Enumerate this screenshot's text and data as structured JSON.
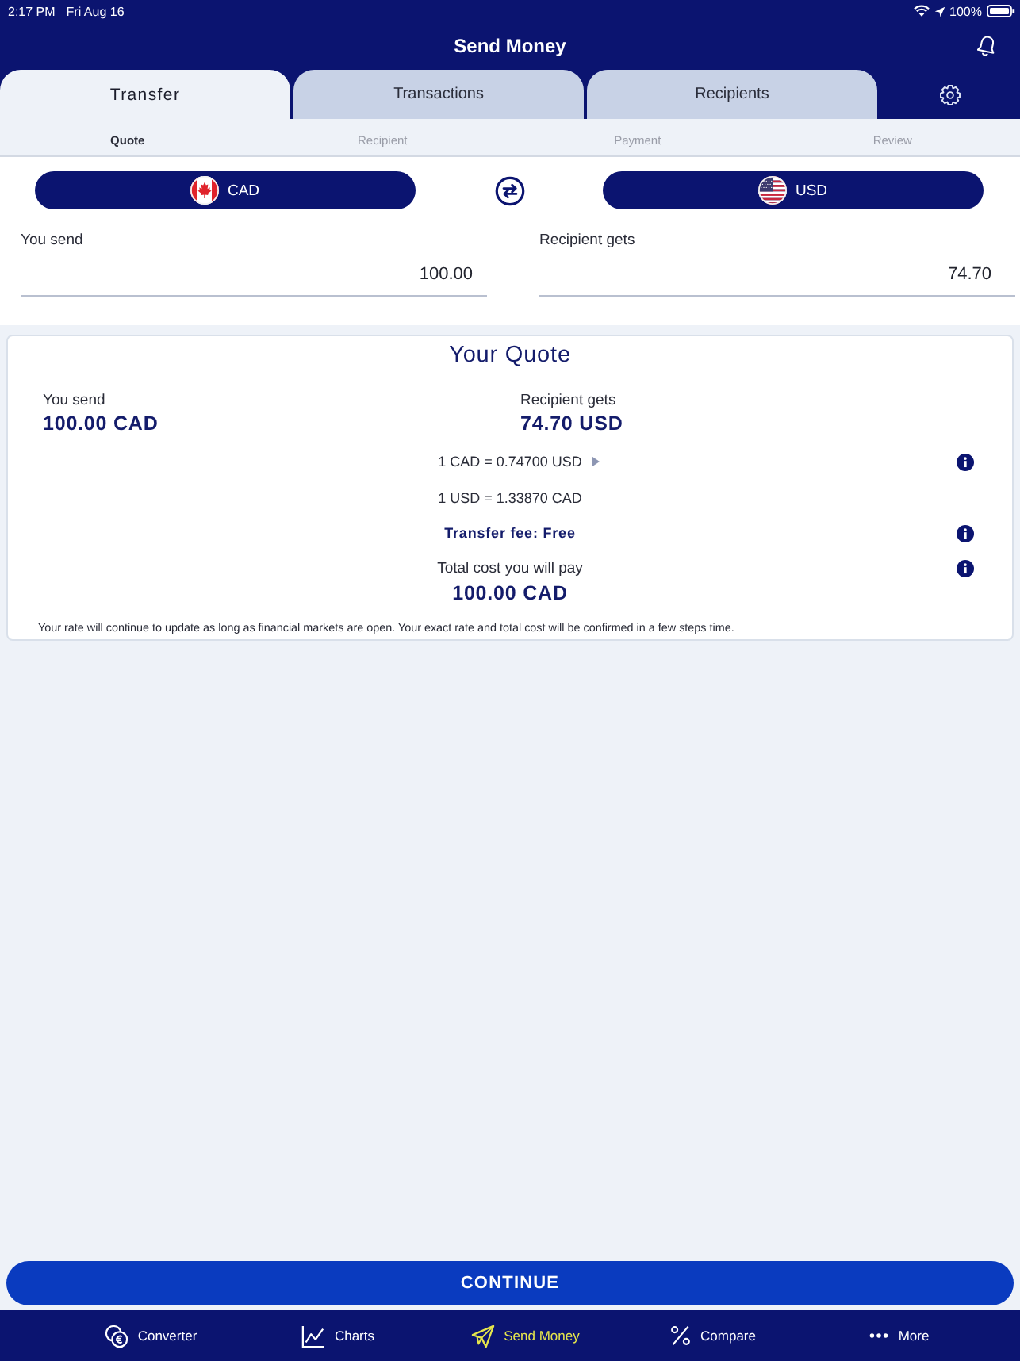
{
  "status_bar": {
    "time": "2:17 PM",
    "date": "Fri Aug 16",
    "battery": "100%"
  },
  "header": {
    "title": "Send Money"
  },
  "tabs": [
    {
      "label": "Transfer",
      "selected": true
    },
    {
      "label": "Transactions",
      "selected": false
    },
    {
      "label": "Recipients",
      "selected": false
    }
  ],
  "steps": [
    {
      "label": "Quote",
      "selected": true
    },
    {
      "label": "Recipient",
      "selected": false
    },
    {
      "label": "Payment",
      "selected": false
    },
    {
      "label": "Review",
      "selected": false
    }
  ],
  "currencies": [
    {
      "code": "CAD"
    },
    {
      "code": "USD"
    }
  ],
  "amounts": [
    {
      "label": "You send",
      "value": "100.00"
    },
    {
      "label": "Recipient gets",
      "value": "74.70"
    }
  ],
  "quote": {
    "title": "Your Quote",
    "amounts": [
      {
        "label": "You send",
        "value": "100.00 CAD"
      },
      {
        "label": "Recipient gets",
        "value": "74.70 USD"
      }
    ],
    "rows": [
      {
        "kind": "rate",
        "text": "1 CAD = 0.74700 USD",
        "expandable": true,
        "info": true
      },
      {
        "kind": "rate",
        "text": "1 USD = 1.33870 CAD",
        "expandable": false,
        "info": false
      },
      {
        "kind": "fee",
        "text": "Transfer fee: Free",
        "expandable": false,
        "info": true
      },
      {
        "kind": "total",
        "text": "Total cost you will pay",
        "amount": "100.00 CAD",
        "expandable": false,
        "info": true
      }
    ],
    "note": "Your rate will continue to update as long as financial markets are open. Your exact rate and total cost will be confirmed in a few steps time."
  },
  "continue_button": {
    "label": "CONTINUE"
  },
  "bottom_nav": [
    {
      "label": "Converter",
      "selected": false
    },
    {
      "label": "Charts",
      "selected": false
    },
    {
      "label": "Send Money",
      "selected": true
    },
    {
      "label": "Compare",
      "selected": false
    },
    {
      "label": "More",
      "selected": false
    }
  ]
}
